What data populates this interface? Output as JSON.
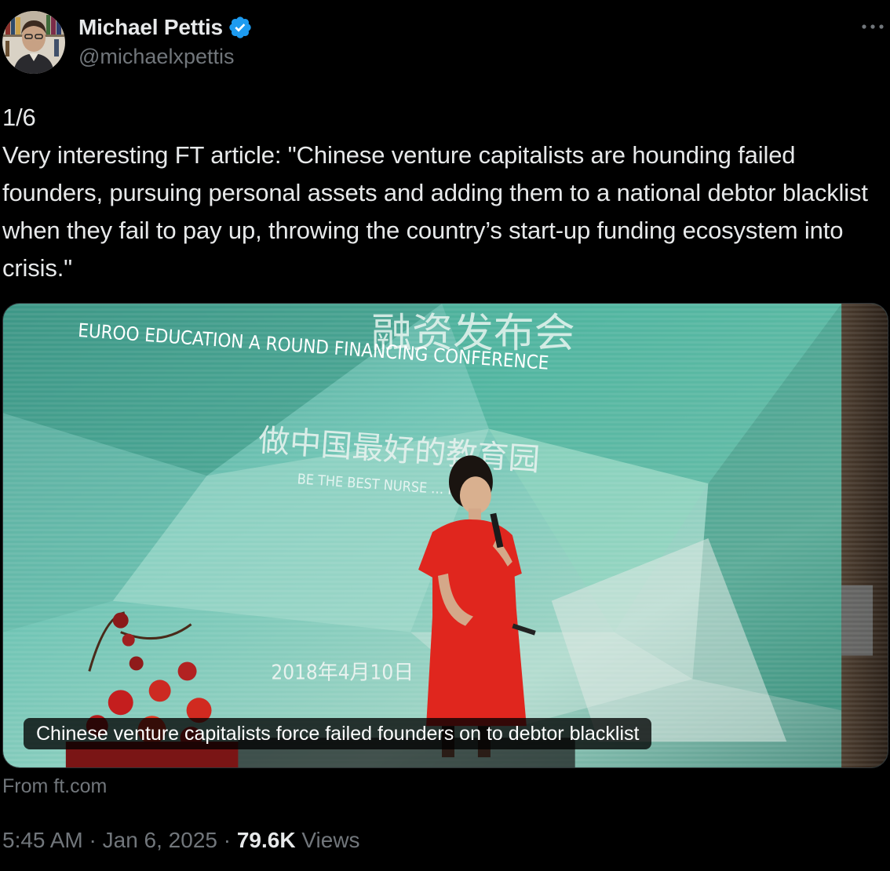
{
  "author": {
    "display_name": "Michael Pettis",
    "handle": "@michaelxpettis",
    "verified": true,
    "verified_icon": "verified-badge-icon",
    "avatar_icon": "profile-photo"
  },
  "more_icon": "more-horizontal-icon",
  "tweet": {
    "text": "1/6\nVery interesting FT article: \"Chinese venture capitalists are hounding failed founders, pursuing personal assets and adding them to a national debtor blacklist when they fail to pay up, throwing the country’s start-up funding ecosystem into crisis.\""
  },
  "link_card": {
    "title": "Chinese venture capitalists force failed founders on to debtor blacklist",
    "source": "From ft.com",
    "image_text": {
      "banner_en": "EUROO EDUCATION A ROUND FINANCING CONFERENCE",
      "banner_cn_top": "融资发布会",
      "banner_cn_mid": "做中国最好的教育园",
      "banner_sub": "BE THE BEST NURSE … INA",
      "date": "2018年4月10日"
    }
  },
  "meta": {
    "time": "5:45 AM",
    "separator": "·",
    "date": "Jan 6, 2025",
    "views_count": "79.6K",
    "views_label": "Views"
  },
  "colors": {
    "background": "#000000",
    "text_primary": "#e7e9ea",
    "text_secondary": "#71767b",
    "verified_blue": "#1d9bf0",
    "card_border": "#2f3336"
  }
}
